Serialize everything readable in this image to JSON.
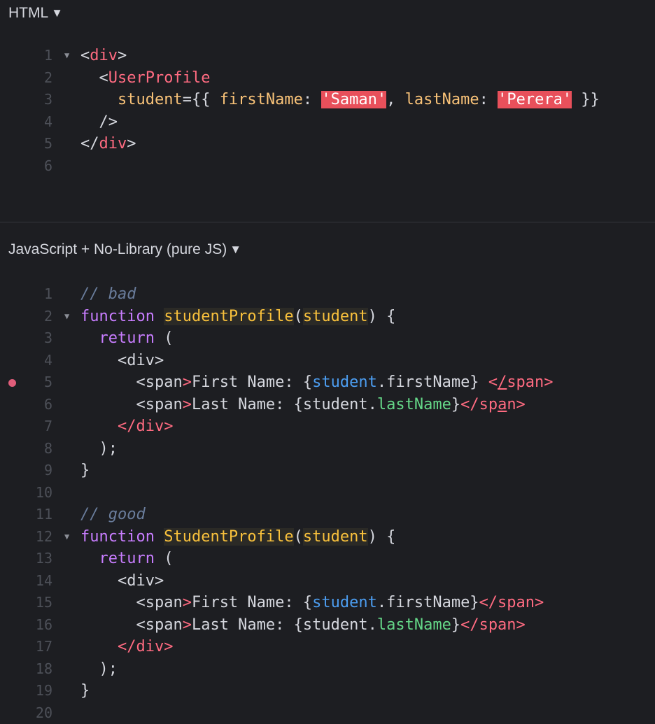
{
  "colors": {
    "background": "#1d1e22",
    "tag": "#ff6b81",
    "attribute": "#f8c278",
    "string_bg": "#e8505b",
    "comment": "#6a7d9c",
    "keyword": "#c87dff",
    "function_name": "#f9c13c",
    "variable": "#4c9df0",
    "property": "#65d888",
    "breakpoint": "#e05d7a"
  },
  "html_panel": {
    "title": "HTML",
    "caret_icon": "caret-down-icon",
    "lines": [
      {
        "num": "1",
        "fold": true,
        "tokens": [
          {
            "t": "<",
            "c": "pun"
          },
          {
            "t": "div",
            "c": "tag"
          },
          {
            "t": ">",
            "c": "pun"
          }
        ]
      },
      {
        "num": "2",
        "fold": false,
        "tokens": [
          {
            "t": "  <",
            "c": "pun"
          },
          {
            "t": "UserProfile",
            "c": "tag"
          }
        ]
      },
      {
        "num": "3",
        "fold": false,
        "tokens": [
          {
            "t": "    student",
            "c": "attr"
          },
          {
            "t": "={{ ",
            "c": "pun"
          },
          {
            "t": "firstName",
            "c": "attr"
          },
          {
            "t": ": ",
            "c": "pun"
          },
          {
            "t": "'Saman'",
            "c": "str"
          },
          {
            "t": ", ",
            "c": "pun"
          },
          {
            "t": "lastName",
            "c": "attr"
          },
          {
            "t": ": ",
            "c": "pun"
          },
          {
            "t": "'Perera'",
            "c": "str"
          },
          {
            "t": " }}",
            "c": "pun"
          }
        ]
      },
      {
        "num": "4",
        "fold": false,
        "tokens": [
          {
            "t": "  />",
            "c": "pun"
          }
        ]
      },
      {
        "num": "5",
        "fold": false,
        "tokens": [
          {
            "t": "</",
            "c": "pun"
          },
          {
            "t": "div",
            "c": "tag"
          },
          {
            "t": ">",
            "c": "pun"
          }
        ]
      },
      {
        "num": "6",
        "fold": false,
        "tokens": []
      }
    ]
  },
  "js_panel": {
    "title": "JavaScript + No-Library (pure JS)",
    "caret_icon": "caret-down-icon",
    "lines": [
      {
        "num": "1",
        "fold": false,
        "tokens": [
          {
            "t": "// bad",
            "c": "cmt"
          }
        ]
      },
      {
        "num": "2",
        "fold": true,
        "tokens": [
          {
            "t": "function",
            "c": "kw"
          },
          {
            "t": " ",
            "c": "text"
          },
          {
            "t": "studentProfile",
            "c": "fn"
          },
          {
            "t": "(",
            "c": "pun"
          },
          {
            "t": "student",
            "c": "param"
          },
          {
            "t": ") {",
            "c": "pun"
          }
        ]
      },
      {
        "num": "3",
        "fold": false,
        "tokens": [
          {
            "t": "  ",
            "c": "text"
          },
          {
            "t": "return",
            "c": "kw"
          },
          {
            "t": " (",
            "c": "pun"
          }
        ]
      },
      {
        "num": "4",
        "fold": false,
        "tokens": [
          {
            "t": "    <",
            "c": "pun"
          },
          {
            "t": "div",
            "c": "pun"
          },
          {
            "t": ">",
            "c": "pun"
          }
        ]
      },
      {
        "num": "5",
        "fold": false,
        "breakpoint": true,
        "tokens": [
          {
            "t": "      <",
            "c": "pun"
          },
          {
            "t": "span",
            "c": "pun"
          },
          {
            "t": ">",
            "c": "tag"
          },
          {
            "t": "First Name: {",
            "c": "text"
          },
          {
            "t": "student",
            "c": "var"
          },
          {
            "t": ".firstName} ",
            "c": "text"
          },
          {
            "t": "<",
            "c": "tag"
          },
          {
            "t": "/",
            "c": "tag-u"
          },
          {
            "t": "span>",
            "c": "tag"
          }
        ]
      },
      {
        "num": "6",
        "fold": false,
        "tokens": [
          {
            "t": "      <",
            "c": "pun"
          },
          {
            "t": "span",
            "c": "pun"
          },
          {
            "t": ">",
            "c": "tag"
          },
          {
            "t": "Last Name: {student.",
            "c": "text"
          },
          {
            "t": "lastName",
            "c": "prop"
          },
          {
            "t": "}",
            "c": "text"
          },
          {
            "t": "</sp",
            "c": "tag"
          },
          {
            "t": "a",
            "c": "tag-u"
          },
          {
            "t": "n>",
            "c": "tag"
          }
        ]
      },
      {
        "num": "7",
        "fold": false,
        "tokens": [
          {
            "t": "    </div>",
            "c": "tag"
          }
        ]
      },
      {
        "num": "8",
        "fold": false,
        "tokens": [
          {
            "t": "  );",
            "c": "pun"
          }
        ]
      },
      {
        "num": "9",
        "fold": false,
        "tokens": [
          {
            "t": "}",
            "c": "pun"
          }
        ]
      },
      {
        "num": "10",
        "fold": false,
        "tokens": []
      },
      {
        "num": "11",
        "fold": false,
        "tokens": [
          {
            "t": "// good",
            "c": "cmt"
          }
        ]
      },
      {
        "num": "12",
        "fold": true,
        "tokens": [
          {
            "t": "function",
            "c": "kw"
          },
          {
            "t": " ",
            "c": "text"
          },
          {
            "t": "StudentProfile",
            "c": "fn"
          },
          {
            "t": "(",
            "c": "pun"
          },
          {
            "t": "student",
            "c": "param"
          },
          {
            "t": ") {",
            "c": "pun"
          }
        ]
      },
      {
        "num": "13",
        "fold": false,
        "tokens": [
          {
            "t": "  ",
            "c": "text"
          },
          {
            "t": "return",
            "c": "kw"
          },
          {
            "t": " (",
            "c": "pun"
          }
        ]
      },
      {
        "num": "14",
        "fold": false,
        "tokens": [
          {
            "t": "    <",
            "c": "pun"
          },
          {
            "t": "div",
            "c": "pun"
          },
          {
            "t": ">",
            "c": "pun"
          }
        ]
      },
      {
        "num": "15",
        "fold": false,
        "tokens": [
          {
            "t": "      <",
            "c": "pun"
          },
          {
            "t": "span",
            "c": "pun"
          },
          {
            "t": ">",
            "c": "tag"
          },
          {
            "t": "First Name: {",
            "c": "text"
          },
          {
            "t": "student",
            "c": "var"
          },
          {
            "t": ".firstName}",
            "c": "text"
          },
          {
            "t": "</span>",
            "c": "tag"
          }
        ]
      },
      {
        "num": "16",
        "fold": false,
        "tokens": [
          {
            "t": "      <",
            "c": "pun"
          },
          {
            "t": "span",
            "c": "pun"
          },
          {
            "t": ">",
            "c": "tag"
          },
          {
            "t": "Last Name: {student.",
            "c": "text"
          },
          {
            "t": "lastName",
            "c": "prop"
          },
          {
            "t": "}",
            "c": "text"
          },
          {
            "t": "</span>",
            "c": "tag"
          }
        ]
      },
      {
        "num": "17",
        "fold": false,
        "tokens": [
          {
            "t": "    </div>",
            "c": "tag"
          }
        ]
      },
      {
        "num": "18",
        "fold": false,
        "tokens": [
          {
            "t": "  );",
            "c": "pun"
          }
        ]
      },
      {
        "num": "19",
        "fold": false,
        "tokens": [
          {
            "t": "}",
            "c": "pun"
          }
        ]
      },
      {
        "num": "20",
        "fold": false,
        "tokens": []
      }
    ]
  }
}
